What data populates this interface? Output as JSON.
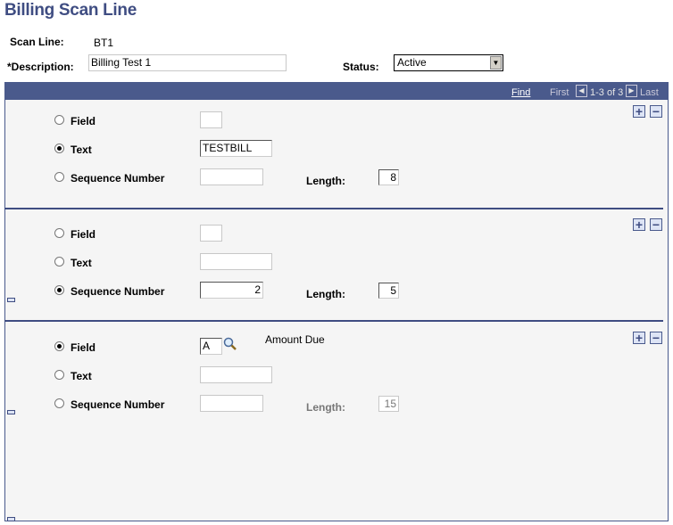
{
  "title": "Billing Scan Line",
  "header": {
    "scan_line_label": "Scan Line:",
    "scan_line_value": "BT1",
    "description_label": "*Description:",
    "description_value": "Billing Test 1",
    "status_label": "Status:",
    "status_value": "Active"
  },
  "grid": {
    "find": "Find",
    "first": "First",
    "range": "1-3 of 3",
    "last": "Last",
    "accent": "#4a5a8c"
  },
  "rows": [
    {
      "field_label": "Field",
      "field_value": "",
      "text_label": "Text",
      "text_value": "TESTBILL",
      "seq_label": "Sequence Number",
      "seq_value": "",
      "length_label": "Length:",
      "length_value": "8",
      "selected": "text"
    },
    {
      "field_label": "Field",
      "field_value": "",
      "text_label": "Text",
      "text_value": "",
      "seq_label": "Sequence Number",
      "seq_value": "2",
      "length_label": "Length:",
      "length_value": "5",
      "selected": "seq"
    },
    {
      "field_label": "Field",
      "field_value": "A",
      "field_desc": "Amount Due",
      "text_label": "Text",
      "text_value": "",
      "seq_label": "Sequence Number",
      "seq_value": "",
      "length_label": "Length:",
      "length_value": "15",
      "selected": "field"
    }
  ]
}
